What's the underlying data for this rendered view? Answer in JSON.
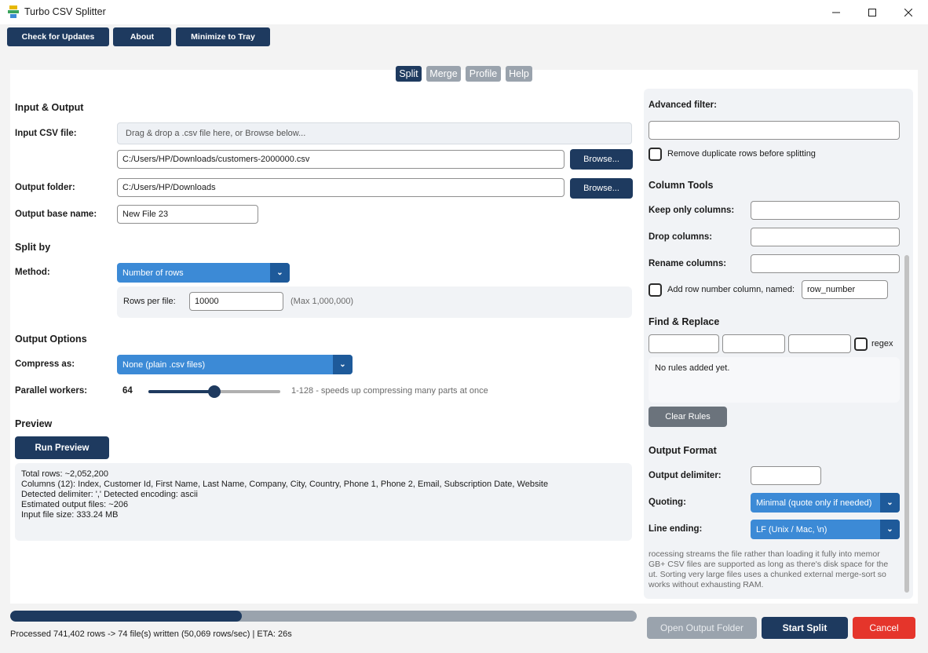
{
  "window": {
    "title": "Turbo CSV Splitter"
  },
  "toolbar": {
    "check_updates": "Check for Updates",
    "about": "About",
    "minimize_tray": "Minimize to Tray"
  },
  "tabs": [
    "Split",
    "Merge",
    "Profile",
    "Help"
  ],
  "left": {
    "io_section": "Input & Output",
    "input_label": "Input CSV file:",
    "dropzone": "Drag & drop a .csv file here, or Browse below...",
    "input_path": "C:/Users/HP/Downloads/customers-2000000.csv",
    "browse": "Browse...",
    "output_folder_label": "Output folder:",
    "output_folder": "C:/Users/HP/Downloads",
    "base_name_label": "Output base name:",
    "base_name": "New File 23",
    "split_section": "Split by",
    "method_label": "Method:",
    "method_value": "Number of rows",
    "rows_per_file_label": "Rows per file:",
    "rows_per_file": "10000",
    "rows_max": "(Max 1,000,000)",
    "output_options_section": "Output Options",
    "compress_label": "Compress as:",
    "compress_value": "None (plain .csv files)",
    "workers_label": "Parallel workers:",
    "workers_value": "64",
    "workers_hint": "1-128 - speeds up compressing many parts at once",
    "workers_level": 64,
    "workers_max": 128,
    "preview_section": "Preview",
    "run_preview": "Run Preview",
    "preview_lines": [
      "Total rows: ~2,052,200",
      "Columns (12): Index, Customer Id, First Name, Last Name, Company, City, Country, Phone 1, Phone 2, Email, Subscription Date, Website",
      "Detected delimiter: ','   Detected encoding: ascii",
      "Estimated output files: ~206",
      "Input file size: 333.24 MB"
    ]
  },
  "right": {
    "advanced_filter_label": "Advanced filter:",
    "advanced_filter_value": "",
    "remove_duplicates": "Remove duplicate rows before splitting",
    "column_tools_section": "Column Tools",
    "keep_only_label": "Keep only columns:",
    "drop_label": "Drop columns:",
    "rename_label": "Rename columns:",
    "add_row_number": "Add row number column, named:",
    "row_number_name": "row_number",
    "find_replace_section": "Find & Replace",
    "regex_label": "regex",
    "no_rules": "No rules added yet.",
    "clear_rules": "Clear Rules",
    "output_format_section": "Output Format",
    "delimiter_label": "Output delimiter:",
    "delimiter_value": "",
    "quoting_label": "Quoting:",
    "quoting_value": "Minimal (quote only if needed)",
    "line_ending_label": "Line ending:",
    "line_ending_value": "LF (Unix / Mac, \\n)",
    "info_lines": [
      "rocessing streams the file rather than loading it fully into memor",
      "GB+ CSV files are supported as long as there's disk space for the",
      "ut. Sorting very large files uses a chunked external merge-sort so",
      "works without exhausting RAM."
    ]
  },
  "status": {
    "text": "Processed 741,402 rows -> 74 file(s) written (50,069 rows/sec) | ETA: 26s",
    "progress": 0.37
  },
  "bottom": {
    "open_output": "Open Output Folder",
    "start_split": "Start Split",
    "cancel": "Cancel"
  },
  "colors": {
    "primary": "#1e3a5f",
    "accent": "#3c8ad6",
    "danger": "#e5352b",
    "disabled": "#9aa3ad"
  }
}
